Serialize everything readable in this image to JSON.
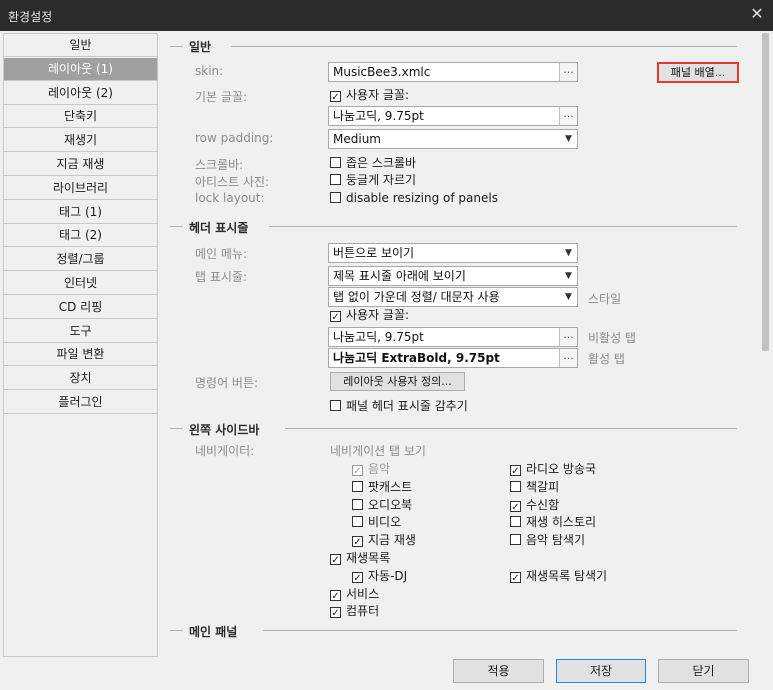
{
  "window": {
    "title": "환경설정",
    "close_glyph": "✕"
  },
  "sidebar": {
    "items": [
      {
        "label": "일반"
      },
      {
        "label": "레이아웃 (1)"
      },
      {
        "label": "레이아웃 (2)"
      },
      {
        "label": "단축키"
      },
      {
        "label": "재생기"
      },
      {
        "label": "지금 재생"
      },
      {
        "label": "라이브러리"
      },
      {
        "label": "태그 (1)"
      },
      {
        "label": "태그 (2)"
      },
      {
        "label": "정렬/그룹"
      },
      {
        "label": "인터넷"
      },
      {
        "label": "CD 리핑"
      },
      {
        "label": "도구"
      },
      {
        "label": "파일 변환"
      },
      {
        "label": "장치"
      },
      {
        "label": "플러그인"
      }
    ],
    "selected_index": 1
  },
  "general": {
    "title": "일반",
    "skin_label": "skin:",
    "skin_value": "MusicBee3.xmlc",
    "panel_button": "패널 배열...",
    "font_label": "기본 글꼴:",
    "custom_font": "사용자 글꼴:",
    "font_value": "나눔고딕, 9.75pt",
    "row_padding_label": "row padding:",
    "row_padding_value": "Medium",
    "scrollbar_label": "스크롤바:",
    "scrollbar_option": "좁은 스크롤바",
    "artist_label": "아티스트 사진:",
    "artist_option": "둥글게 자르기",
    "lock_label": "lock layout:",
    "lock_option": "disable resizing of panels"
  },
  "header": {
    "title": "헤더 표시줄",
    "menu_label": "메인 메뉴:",
    "menu_value": "버튼으로 보이기",
    "tab_label": "탭 표시줄:",
    "tab_value": "제목 표시줄 아래에 보이기",
    "tab_style_value": "탭 없이 가운데 정렬/ 대문자 사용",
    "style_label": "스타일",
    "custom_font": "사용자 글꼴:",
    "inactive_font": "나눔고딕, 9.75pt",
    "inactive_label": "비활성 탭",
    "active_font": "나눔고딕 ExtraBold, 9.75pt",
    "active_label": "활성 탭",
    "command_label": "명령어 버튼:",
    "command_button": "레이아웃 사용자 정의...",
    "hide_header": "패널 헤더 표시줄 감추기"
  },
  "left_sidebar": {
    "title": "왼쪽 사이드바",
    "navigator_label": "네비게이터:",
    "nav_tab_label": "네비게이션 탭 보기",
    "col1": [
      {
        "label": "음악",
        "checked": true,
        "disabled": true,
        "indent": 1
      },
      {
        "label": "팟캐스트",
        "checked": false,
        "indent": 1
      },
      {
        "label": "오디오북",
        "checked": false,
        "indent": 1
      },
      {
        "label": "비디오",
        "checked": false,
        "indent": 1
      },
      {
        "label": "지금 재생",
        "checked": true,
        "indent": 1
      },
      {
        "label": "재생목록",
        "checked": true,
        "indent": 0
      },
      {
        "label": "자동-DJ",
        "checked": true,
        "indent": 1
      },
      {
        "label": "서비스",
        "checked": true,
        "indent": 0
      },
      {
        "label": "컴퓨터",
        "checked": true,
        "indent": 0
      }
    ],
    "col2": [
      {
        "label": "라디오 방송국",
        "checked": true,
        "row": 0
      },
      {
        "label": "책갈피",
        "checked": false,
        "row": 1
      },
      {
        "label": "수신함",
        "checked": true,
        "row": 2
      },
      {
        "label": "재생 히스토리",
        "checked": false,
        "row": 3
      },
      {
        "label": "음악 탐색기",
        "checked": false,
        "row": 4
      },
      {
        "label": "재생목록 탐색기",
        "checked": true,
        "row": 6
      }
    ]
  },
  "main_panel": {
    "title": "메인 패널"
  },
  "footer": {
    "apply": "적용",
    "save": "저장",
    "close": "닫기"
  },
  "colors": {
    "highlight": "#e53935",
    "selected_bg": "#a0a0a0",
    "primary_border": "#1e88e5"
  },
  "check_glyph": "✓"
}
